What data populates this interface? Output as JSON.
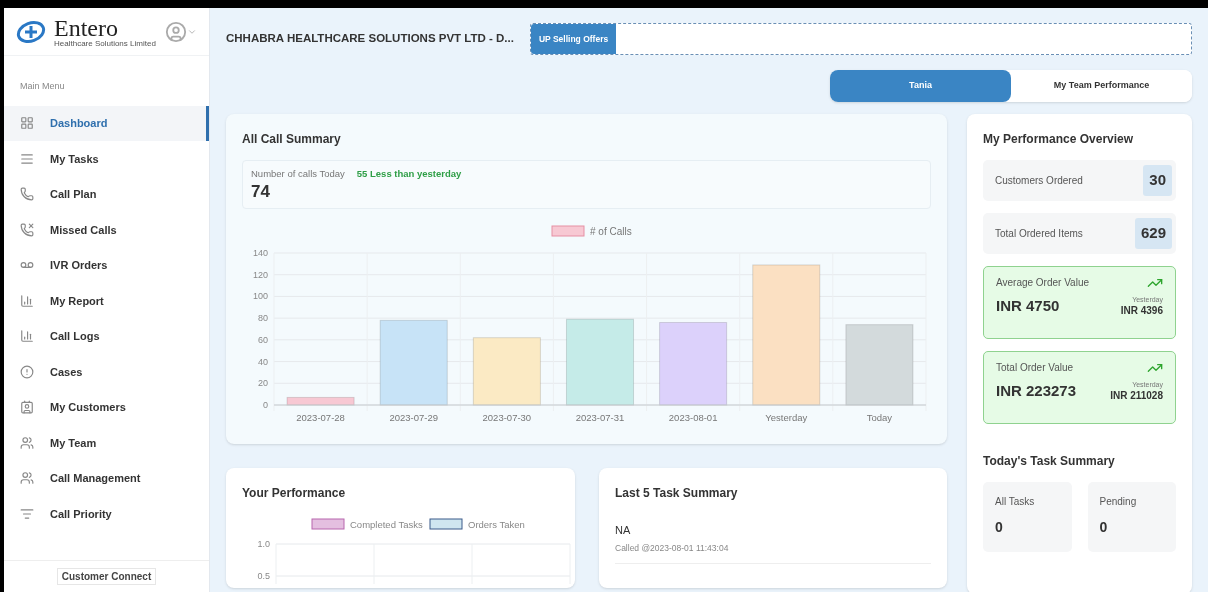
{
  "sidebar": {
    "logo": {
      "name": "Entero",
      "tagline": "Healthcare Solutions Limited"
    },
    "section_label": "Main Menu",
    "items": [
      {
        "label": "Dashboard",
        "selected": true
      },
      {
        "label": "My Tasks",
        "selected": false
      },
      {
        "label": "Call Plan",
        "selected": false
      },
      {
        "label": "Missed Calls",
        "selected": false
      },
      {
        "label": "IVR Orders",
        "selected": false
      },
      {
        "label": "My Report",
        "selected": false
      },
      {
        "label": "Call Logs",
        "selected": false
      },
      {
        "label": "Cases",
        "selected": false
      },
      {
        "label": "My Customers",
        "selected": false
      },
      {
        "label": "My Team",
        "selected": false
      },
      {
        "label": "Call Management",
        "selected": false
      },
      {
        "label": "Call Priority",
        "selected": false
      }
    ],
    "footer_button": "Customer Connect"
  },
  "header": {
    "title": "CHHABRA HEALTHCARE SOLUTIONS PVT LTD - D...",
    "upselling_label": "UP Selling Offers"
  },
  "tabs": [
    {
      "label": "Tania",
      "selected": true
    },
    {
      "label": "My Team Performance",
      "selected": false
    }
  ],
  "call_summary": {
    "title": "All Call Summary",
    "stat_label": "Number of calls Today",
    "stat_change": "55 Less than yesterday",
    "stat_value": "74",
    "chart_data": {
      "type": "bar",
      "categories": [
        "2023-07-28",
        "2023-07-29",
        "2023-07-30",
        "2023-07-31",
        "2023-08-01",
        "Yesterday",
        "Today"
      ],
      "ylim": [
        0,
        140
      ],
      "yticks": [
        0,
        20,
        40,
        60,
        80,
        100,
        120,
        140
      ],
      "grid": true,
      "series": [
        {
          "name": "# of Calls",
          "color": "#f7c8d3",
          "values": [
            7,
            null,
            null,
            null,
            null,
            null,
            null
          ]
        },
        {
          "color": "#c7e3f7",
          "values": [
            null,
            78,
            null,
            null,
            null,
            null,
            null
          ]
        },
        {
          "color": "#fbeac4",
          "values": [
            null,
            null,
            62,
            null,
            null,
            null,
            null
          ]
        },
        {
          "color": "#c5ebe8",
          "values": [
            null,
            null,
            null,
            79,
            null,
            null,
            null
          ]
        },
        {
          "color": "#dcd1fb",
          "values": [
            null,
            null,
            null,
            null,
            76,
            null,
            null
          ]
        },
        {
          "color": "#fbe0c2",
          "values": [
            null,
            null,
            null,
            null,
            null,
            129,
            null
          ]
        },
        {
          "color": "#d3dadc",
          "values": [
            null,
            null,
            null,
            null,
            null,
            null,
            74
          ]
        }
      ]
    }
  },
  "your_performance": {
    "title": "Your Performance",
    "chart_data": {
      "type": "bar",
      "ylim": [
        0,
        1
      ],
      "yticks": [
        0.5,
        {
          "value": 1,
          "label": "1.0"
        }
      ],
      "series": [
        {
          "name": "Completed Tasks",
          "color": "#e4bfe0",
          "values": [
            null,
            null,
            null
          ]
        },
        {
          "name": "Orders Taken",
          "color": "#cfe6f0",
          "values": [
            null,
            null,
            null
          ]
        }
      ]
    }
  },
  "last_tasks": {
    "title": "Last 5 Task Summary",
    "items": [
      {
        "name": "NA",
        "detail": "Called @2023-08-01 11:43:04"
      }
    ]
  },
  "overview": {
    "title": "My Performance Overview",
    "stats": [
      {
        "kind": "count",
        "label": "Customers Ordered",
        "value": "30"
      },
      {
        "kind": "count",
        "label": "Total Ordered Items",
        "value": "629"
      },
      {
        "kind": "trend",
        "label": "Average Order Value",
        "value": "INR 4750",
        "compare_label": "Yesterday",
        "compare_value": "INR 4396"
      },
      {
        "kind": "trend",
        "label": "Total Order Value",
        "value": "INR 223273",
        "compare_label": "Yesterday",
        "compare_value": "INR 211028"
      }
    ],
    "task_title": "Today's Task Summary",
    "tasks": [
      {
        "label": "All Tasks",
        "value": "0"
      },
      {
        "label": "Pending",
        "value": "0"
      }
    ]
  }
}
